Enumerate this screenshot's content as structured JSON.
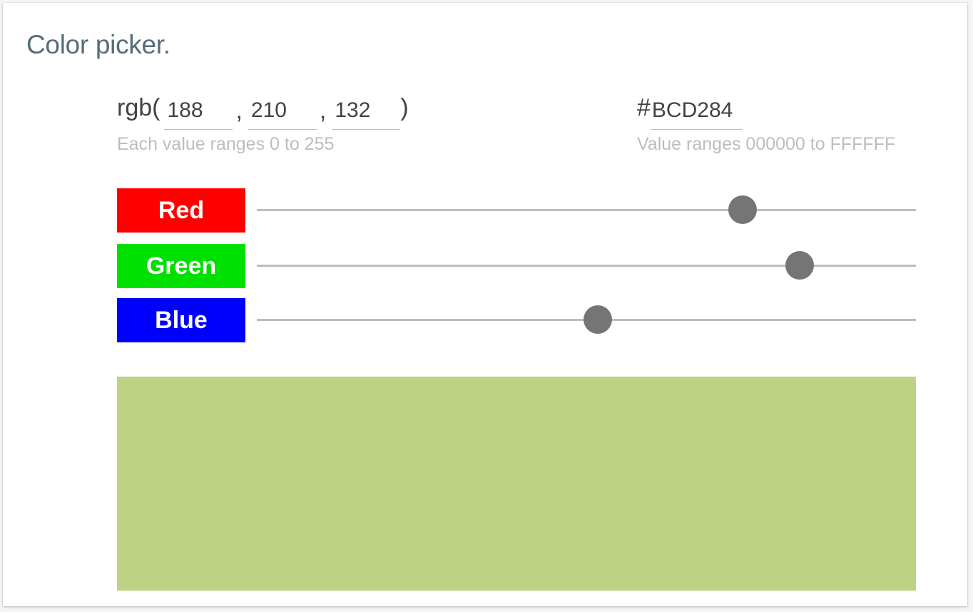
{
  "title": "Color picker.",
  "rgb": {
    "prefix": "rgb(",
    "separator": ",",
    "suffix": ")",
    "r": "188",
    "g": "210",
    "b": "132",
    "hint": "Each value ranges 0 to 255"
  },
  "hex": {
    "prefix": "#",
    "value": "BCD284",
    "hint": "Value ranges 000000 to FFFFFF"
  },
  "sliders": [
    {
      "label": "Red",
      "value": 188,
      "max": 255,
      "color": "#ff0000"
    },
    {
      "label": "Green",
      "value": 210,
      "max": 255,
      "color": "#00e000"
    },
    {
      "label": "Blue",
      "value": 132,
      "max": 255,
      "color": "#0000ff"
    }
  ],
  "preview_color": "#bdd284"
}
